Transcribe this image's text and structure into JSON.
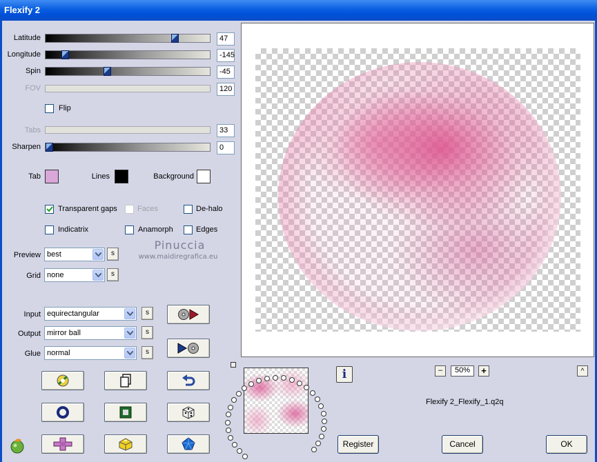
{
  "window": {
    "title": "Flexify 2"
  },
  "sliders": {
    "latitude": {
      "label": "Latitude",
      "value": "47",
      "fraction": 0.8
    },
    "longitude": {
      "label": "Longitude",
      "value": "-145",
      "fraction": 0.1
    },
    "spin": {
      "label": "Spin",
      "value": "-45",
      "fraction": 0.37
    },
    "fov": {
      "label": "FOV",
      "value": "120"
    },
    "tabs": {
      "label": "Tabs",
      "value": "33"
    },
    "sharpen": {
      "label": "Sharpen",
      "value": "0",
      "fraction": 0.0
    }
  },
  "flip": {
    "label": "Flip",
    "checked": false
  },
  "colors": {
    "tab": {
      "label": "Tab",
      "color": "#d9a7d9"
    },
    "lines": {
      "label": "Lines",
      "color": "#000000"
    },
    "background": {
      "label": "Background",
      "color": "#ffffff"
    }
  },
  "options": {
    "transparent_gaps": {
      "label": "Transparent gaps",
      "checked": true
    },
    "faces": {
      "label": "Faces",
      "checked": false
    },
    "de_halo": {
      "label": "De-halo",
      "checked": false
    },
    "indicatrix": {
      "label": "Indicatrix",
      "checked": false
    },
    "anamorph": {
      "label": "Anamorph",
      "checked": false
    },
    "edges": {
      "label": "Edges",
      "checked": false
    }
  },
  "watermark": {
    "name": "Pinuccia",
    "url": "www.maidiregrafica.eu"
  },
  "dropdowns": {
    "preview": {
      "label": "Preview",
      "value": "best"
    },
    "grid": {
      "label": "Grid",
      "value": "none"
    },
    "input": {
      "label": "Input",
      "value": "equirectangular"
    },
    "output": {
      "label": "Output",
      "value": "mirror ball"
    },
    "glue": {
      "label": "Glue",
      "value": "normal"
    }
  },
  "small_button_label": "s",
  "zoom": {
    "value": "50%",
    "minus": "–",
    "plus": "+"
  },
  "preset_name": "Flexify 2_Flexify_1.q2q",
  "info_label": "i",
  "collapse_label": "^",
  "buttons": {
    "register": "Register",
    "cancel": "Cancel",
    "ok": "OK"
  }
}
